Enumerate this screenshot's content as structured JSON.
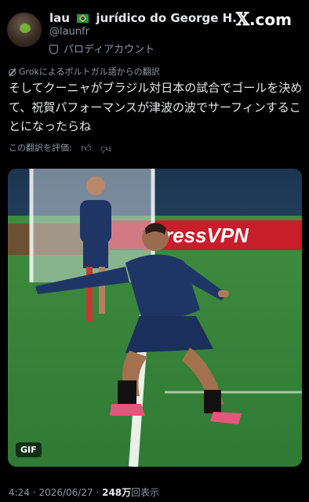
{
  "user": {
    "name_prefix": "lau",
    "name_suffix": "jurídico do George H...",
    "handle": "@launfr",
    "label": "パロディアカウント"
  },
  "brand": {
    "x": "𝕏",
    "text": ".com"
  },
  "translation": {
    "notice": "Grokによるポルトガル語からの翻訳",
    "rate": "この翻訳を評価:"
  },
  "tweet": {
    "text": "そしてクーニャがブラジル対日本の試合でゴールを決めて、祝賀パフォーマンスが津波の波でサーフィンすることになったらね"
  },
  "media": {
    "badge": "GIF",
    "banner": "ressVPN"
  },
  "meta": {
    "time": "4:24",
    "date": "2026/06/27",
    "views_count": "248万",
    "views_label": "回表示"
  },
  "colors": {
    "background": "#000000",
    "text": "#e7e9ea",
    "secondary": "#8b98a5",
    "pitch": "#3c8a3f",
    "banner": "#c81d2a",
    "kit": "#1f3566"
  }
}
